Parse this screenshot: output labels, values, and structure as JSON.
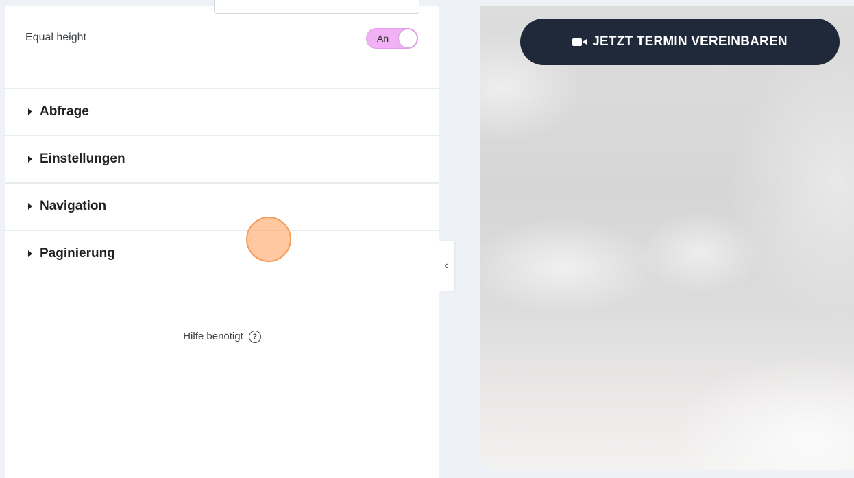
{
  "panel": {
    "equal_height": {
      "label": "Equal height",
      "toggle_label": "An",
      "enabled": true
    },
    "sections": [
      {
        "title": "Abfrage"
      },
      {
        "title": "Einstellungen"
      },
      {
        "title": "Navigation"
      },
      {
        "title": "Paginierung"
      }
    ],
    "help": {
      "label": "Hilfe benötigt",
      "icon_glyph": "?"
    },
    "collapse_glyph": "‹"
  },
  "preview": {
    "cta_label": "JETZT TERMIN VEREINBAREN",
    "cta_icon": "video-camera-icon",
    "cta_color": "#1f2939"
  },
  "colors": {
    "toggle_on": "#f0b2f4",
    "cursor_highlight": "#ffaa6e"
  }
}
